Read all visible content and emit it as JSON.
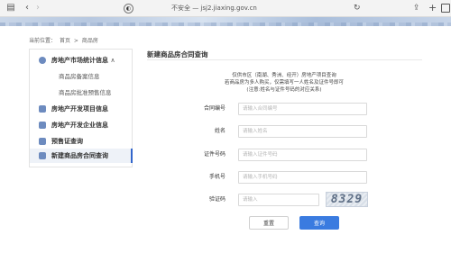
{
  "browser": {
    "address": "不安全 — jsj2.jiaxing.gov.cn"
  },
  "breadcrumb": {
    "prefix": "当前位置：",
    "home": "首页",
    "separator": ">",
    "current": "商品房"
  },
  "sidebar": {
    "items": [
      {
        "label": "房地产市场统计信息",
        "expanded_marker": "∧"
      },
      {
        "label": "商品房备案信息"
      },
      {
        "label": "商品房批准预售信息"
      },
      {
        "label": "房地产开发项目信息"
      },
      {
        "label": "房地产开发企业信息"
      },
      {
        "label": "预售证查询"
      },
      {
        "label": "新建商品房合同查询"
      }
    ]
  },
  "main": {
    "title": "新建商品房合同查询",
    "notice": [
      "仅供市区（南湖、秀洲、经开）房地产项目查询",
      "若商品房为多人购买，仅需填写一人姓名及证件号即可",
      "(注意:姓名与证件号码的对应关系)"
    ]
  },
  "form": {
    "contract_no": {
      "label": "合同编号",
      "placeholder": "请输入合同编号"
    },
    "name": {
      "label": "姓名",
      "placeholder": "请输入姓名"
    },
    "id_no": {
      "label": "证件号码",
      "placeholder": "请输入证件号码"
    },
    "phone": {
      "label": "手机号",
      "placeholder": "请输入手机号码"
    },
    "captcha": {
      "label": "验证码",
      "placeholder": "请输入",
      "image_text": "8329"
    }
  },
  "buttons": {
    "reset": "重置",
    "query": "查询"
  },
  "colors": {
    "accent": "#3a7be0",
    "active_bg": "#eef2f8"
  }
}
